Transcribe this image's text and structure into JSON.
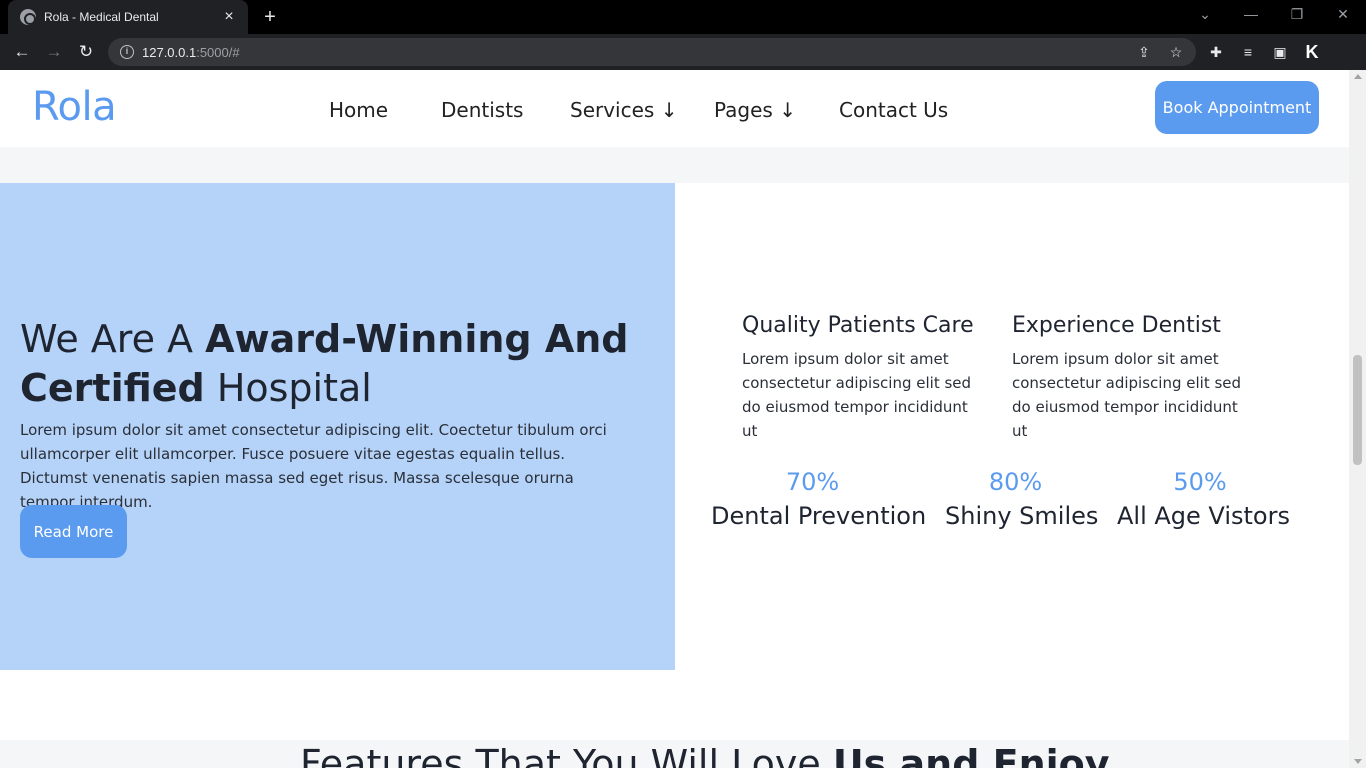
{
  "browser": {
    "tab_title": "Rola - Medical Dental",
    "tab_close": "×",
    "new_tab": "+",
    "url_host": "127.0.0.1",
    "url_rest": ":5000/#",
    "back": "←",
    "forward": "→",
    "reload": "↻",
    "win_dropdown": "⌄",
    "win_minimize": "—",
    "win_restore": "❐",
    "win_close": "✕",
    "share": "⇪",
    "bookmark": "☆",
    "extensions": "✚",
    "media": "≡",
    "sidepanel": "▣",
    "profile": "K"
  },
  "header": {
    "logo": "Rola",
    "nav": [
      "Home",
      "Dentists",
      "Services ↓",
      "Pages ↓",
      "Contact Us"
    ],
    "cta": "Book Appointment"
  },
  "hero": {
    "title_1": "We Are A ",
    "title_2": "Award-Winning And Certified",
    "title_3": " Hospital",
    "description": "Lorem ipsum dolor sit amet consectetur adipiscing elit. Coectetur tibulum orci ullamcorper elit ullamcorper. Fusce posuere vitae egestas equalin tellus. Dictumst venenatis sapien massa sed eget risus. Massa scelesque orurna tempor interdum.",
    "button": "Read More"
  },
  "features": [
    {
      "title": "Quality Patients Care",
      "text": "Lorem ipsum dolor sit amet consectetur adipiscing elit sed do eiusmod tempor incididunt ut"
    },
    {
      "title": "Experience Dentist",
      "text": "Lorem ipsum dolor sit amet consectetur adipiscing elit sed do eiusmod tempor incididunt ut"
    }
  ],
  "stats": [
    {
      "value": "70%",
      "label": "Dental Prevention"
    },
    {
      "value": "80%",
      "label": "Shiny Smiles"
    },
    {
      "value": "50%",
      "label": "All Age Vistors"
    }
  ],
  "section_heading": {
    "part_1": "Features That You Will Love ",
    "part_2": "Us and Enjoy"
  },
  "colors": {
    "accent": "#5b9bef",
    "hero_bg": "#b5d3f9",
    "text_dark": "#1e2430"
  }
}
